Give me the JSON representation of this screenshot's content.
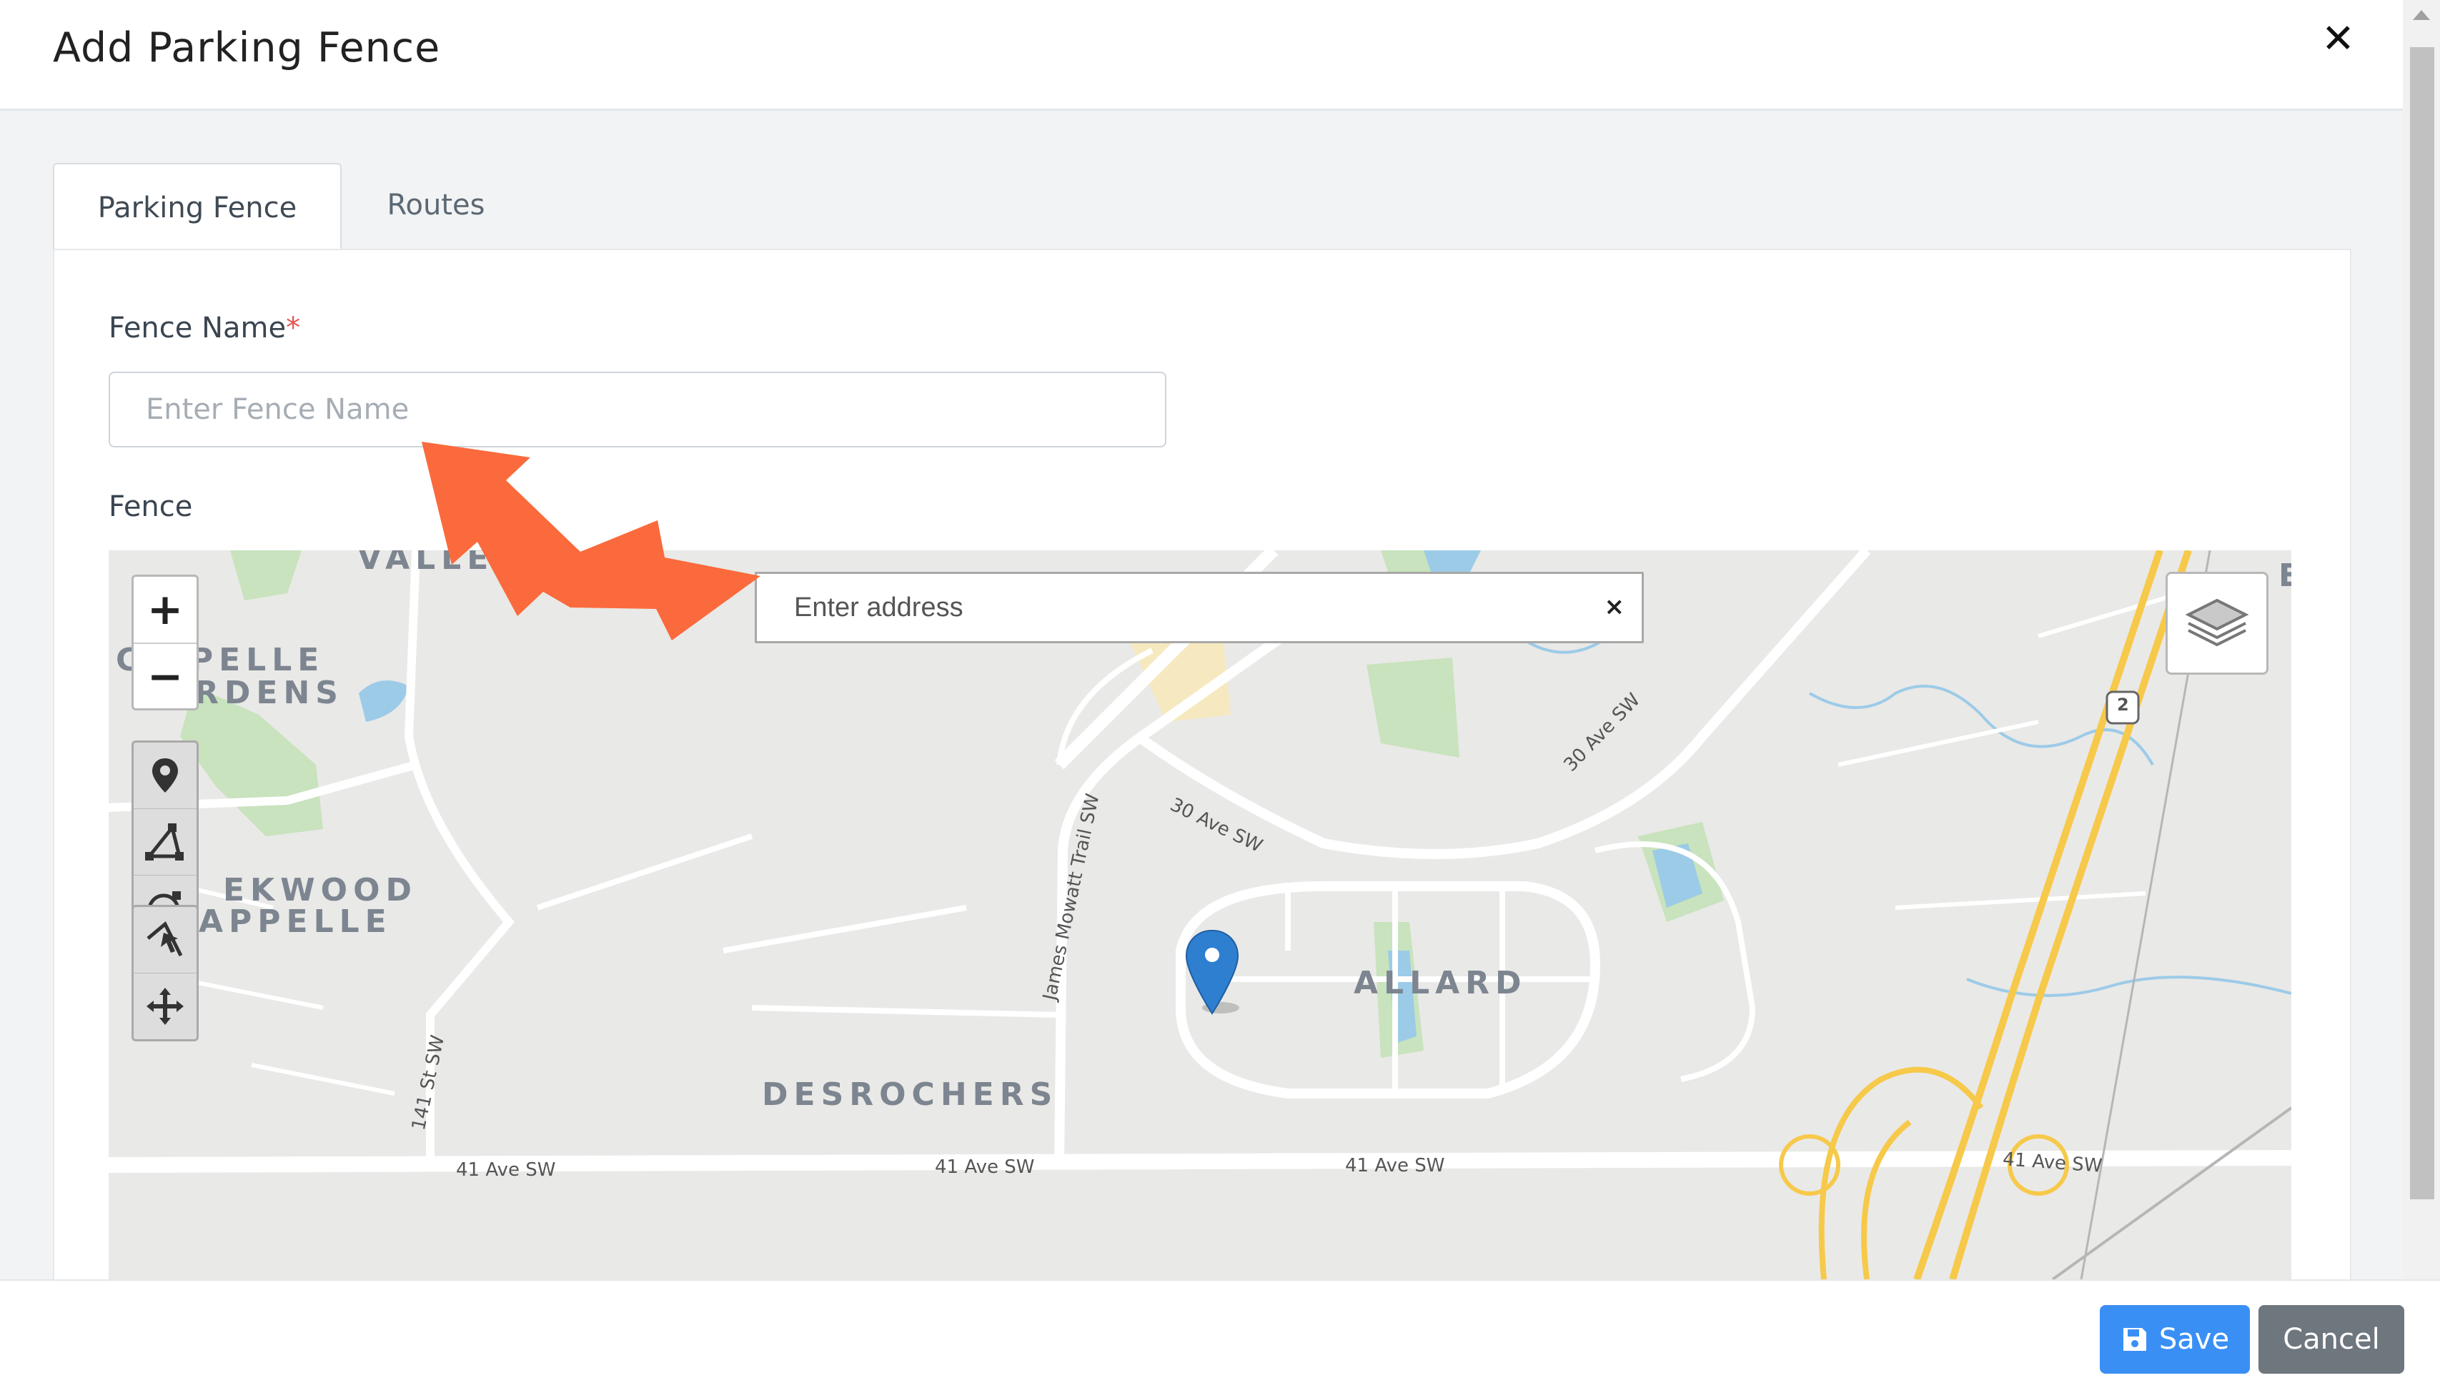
{
  "modal": {
    "title": "Add Parking Fence",
    "close_icon": "close-icon"
  },
  "tabs": [
    {
      "label": "Parking Fence",
      "active": true
    },
    {
      "label": "Routes",
      "active": false
    }
  ],
  "form": {
    "fence_name_label": "Fence Name",
    "required_mark": "*",
    "fence_name_placeholder": "Enter Fence Name",
    "fence_name_value": "",
    "fence_label": "Fence"
  },
  "map": {
    "address_placeholder": "Enter address",
    "address_clear": "×",
    "zoom_in": "+",
    "zoom_out": "−",
    "draw_tools": [
      "marker-icon",
      "polygon-icon",
      "circle-icon"
    ],
    "edit_tools": [
      "edit-icon",
      "move-icon"
    ],
    "layers_icon": "layers-icon",
    "place_labels": {
      "valley": "VALLEY",
      "qu_appelle_gardens_1": "C   PPELLE",
      "qu_appelle_gardens_2": "RDENS",
      "creekwood_1": "EKWOOD",
      "creekwood_2": "APPELLE",
      "allard": "ALLARD",
      "desrochers": "DESROCHERS",
      "edge": "E"
    },
    "road_labels": {
      "ave41_a": "41 Ave SW",
      "ave41_b": "41 Ave SW",
      "ave41_c": "41 Ave SW",
      "ave41_d": "41 Ave SW",
      "ave30_a": "30 Ave SW",
      "ave30_b": "30 Ave SW",
      "james_mowatt": "James Mowatt Trail SW",
      "st141": "141 St SW",
      "hwy2": "2"
    },
    "colors": {
      "land": "#e9e9e7",
      "park": "#c8e3bd",
      "water": "#9ccbe8",
      "road": "#ffffff",
      "highway": "#f7c94a",
      "pin": "#2f7fd1"
    }
  },
  "annotation": {
    "arrow_color": "#fb6a3c"
  },
  "footer": {
    "save_label": "Save",
    "cancel_label": "Cancel"
  }
}
